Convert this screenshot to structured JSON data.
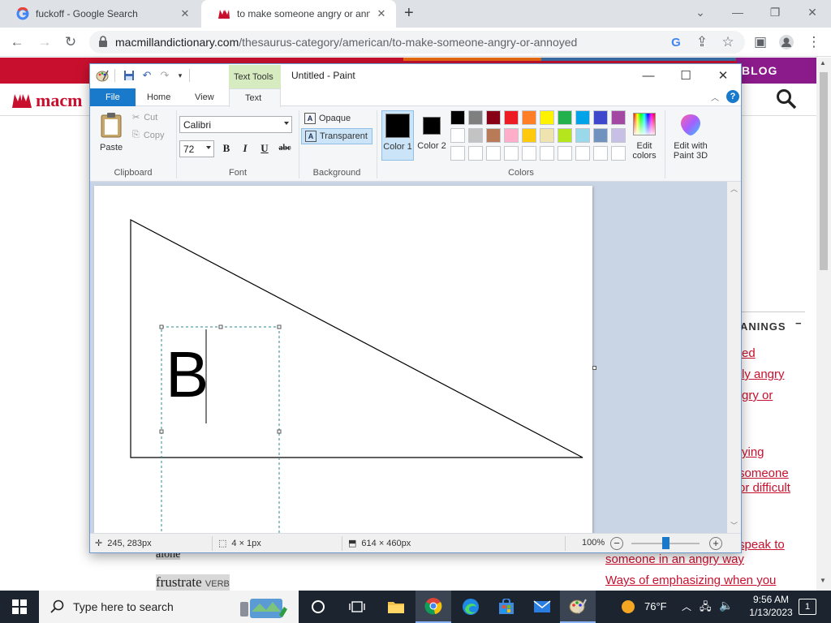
{
  "browser": {
    "tabs": [
      {
        "title": "fuckoff - Google Search",
        "active": false,
        "favicon": "google-g-icon"
      },
      {
        "title": "to make someone angry or annoyed",
        "active": true,
        "favicon": "macmillan-icon"
      }
    ],
    "new_tab_label": "+",
    "url_host": "macmillandictionary.com",
    "url_path": "/thesaurus-category/american/to-make-someone-angry-or-annoyed",
    "window_controls": [
      "chevron-down-icon",
      "minimize-icon",
      "restore-icon",
      "close-icon"
    ]
  },
  "site": {
    "logo": "macm",
    "blog_label": "BLOG",
    "meanings_heading": "ANINGS",
    "meanings_collapse": "−",
    "right_links": [
      "ed",
      "ly angry",
      "gry or",
      "ying",
      " someone",
      "or difficult",
      " speak to",
      "someone in an angry way",
      "Ways of emphasizing when you"
    ],
    "left_words": [
      {
        "word": "alone",
        "pos": ""
      },
      {
        "word": "frustrate",
        "pos": "VERB"
      }
    ],
    "accent_color": "#c8102e"
  },
  "paint": {
    "title": "Untitled - Paint",
    "context_tab": "Text Tools",
    "tabs": [
      "File",
      "Home",
      "View",
      "Text"
    ],
    "clipboard": {
      "paste": "Paste",
      "cut": "Cut",
      "copy": "Copy",
      "label": "Clipboard"
    },
    "font": {
      "name": "Calibri",
      "size": "72",
      "label": "Font",
      "bold": "B",
      "italic": "I",
      "underline": "U",
      "strike": "abc"
    },
    "background": {
      "opaque": "Opaque",
      "transparent": "Transparent",
      "label": "Background",
      "selected": "Transparent"
    },
    "colors": {
      "color1_label": "Color 1",
      "color2_label": "Color 2",
      "color1": "#000000",
      "color2": "#000000",
      "edit_label": "Edit colors",
      "paint3d_label": "Edit with Paint 3D",
      "label": "Colors",
      "palette_row1": [
        "#000000",
        "#7f7f7f",
        "#880015",
        "#ed1c24",
        "#ff7f27",
        "#fff200",
        "#22b14c",
        "#00a2e8",
        "#3f48cc",
        "#a349a4"
      ],
      "palette_row2": [
        "#ffffff",
        "#c3c3c3",
        "#b97a57",
        "#ffaec9",
        "#ffc90e",
        "#efe4b0",
        "#b5e61d",
        "#99d9ea",
        "#7092be",
        "#c8bfe7"
      ]
    },
    "text_content": "B",
    "status": {
      "cursor_pos": "245, 283px",
      "selection_size": "4 × 1px",
      "image_size": "614 × 460px",
      "zoom": "100%"
    }
  },
  "taskbar": {
    "search_placeholder": "Type here to search",
    "weather": "76°F",
    "time": "9:56 AM",
    "date": "1/13/2023",
    "notification_count": "1",
    "pinned": [
      "task-view-icon",
      "file-explorer-icon",
      "chrome-icon",
      "edge-icon",
      "store-icon",
      "mail-icon",
      "paint-icon"
    ]
  }
}
